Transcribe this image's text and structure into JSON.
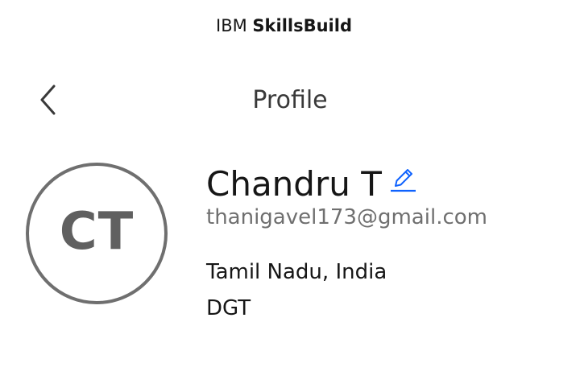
{
  "header": {
    "brand_regular": "IBM ",
    "brand_bold": "SkillsBuild",
    "back_icon": "chevron-left-icon"
  },
  "page": {
    "title": "Profile"
  },
  "profile": {
    "initials": "CT",
    "name": "Chandru T",
    "edit_icon": "pencil-edit-icon",
    "email": "thanigavel173@gmail.com",
    "location": "Tamil Nadu, India",
    "organization": "DGT"
  },
  "colors": {
    "text": "#161616",
    "secondary_text": "#6f6f6f",
    "avatar_ring": "#6f6f6f",
    "edit_icon": "#0f62fe"
  }
}
